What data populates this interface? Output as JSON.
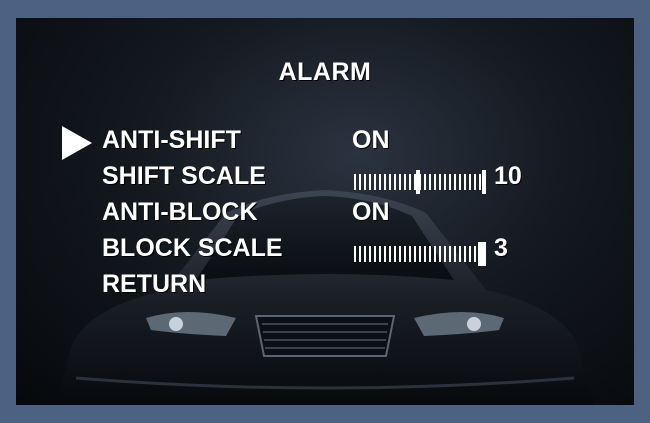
{
  "osd": {
    "title": "ALARM",
    "selected_index": 0,
    "items": [
      {
        "label": "ANTI-SHIFT",
        "value": "ON"
      },
      {
        "label": "SHIFT SCALE",
        "value": "10",
        "level": 10,
        "max": 20
      },
      {
        "label": "ANTI-BLOCK",
        "value": "ON"
      },
      {
        "label": "BLOCK SCALE",
        "value": "3",
        "level": 20,
        "max": 20
      },
      {
        "label": "RETURN"
      }
    ]
  },
  "colors": {
    "frame": "#4d6282",
    "text": "#ffffff"
  },
  "icons": {
    "cursor": "right-triangle-cursor-icon"
  }
}
